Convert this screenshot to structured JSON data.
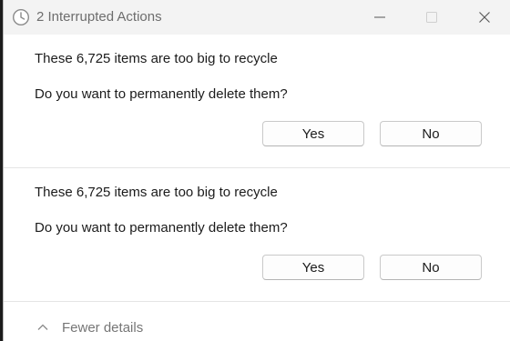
{
  "window": {
    "title": "2 Interrupted Actions",
    "icon": "clock-icon",
    "controls": {
      "minimize_icon": "minimize-icon",
      "maximize_icon": "maximize-icon",
      "close_icon": "close-icon"
    }
  },
  "actions": [
    {
      "message": "These 6,725 items are too big to recycle",
      "question": "Do you want to permanently delete them?",
      "yes_label": "Yes",
      "no_label": "No"
    },
    {
      "message": "These 6,725 items are too big to recycle",
      "question": "Do you want to permanently delete them?",
      "yes_label": "Yes",
      "no_label": "No"
    }
  ],
  "footer": {
    "details_label": "Fewer details",
    "details_icon": "chevron-up-icon"
  },
  "colors": {
    "titlebar_bg": "#f3f3f3",
    "window_bg": "#ffffff",
    "text": "#1b1b1b",
    "muted_text": "#767676"
  }
}
